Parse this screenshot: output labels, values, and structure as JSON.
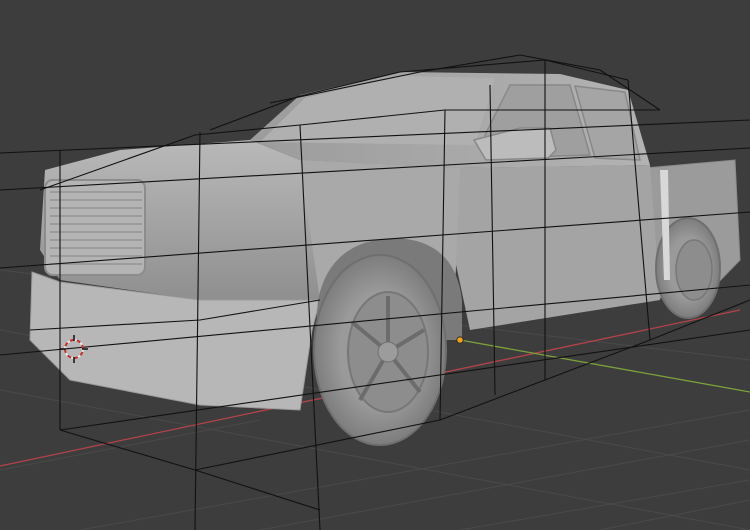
{
  "viewport": {
    "background": "#3d3d3d",
    "grid_color": "#4a4a4a",
    "x_axis_color": "#b4434a",
    "y_axis_color": "#7da13a",
    "cage_color": "#111111",
    "model_fill": "#a6a6a6",
    "model_shade": "#8a8a8a",
    "origin_color": "#f0a020",
    "icons": [
      "3d-cursor-icon",
      "origin-point-icon"
    ]
  }
}
